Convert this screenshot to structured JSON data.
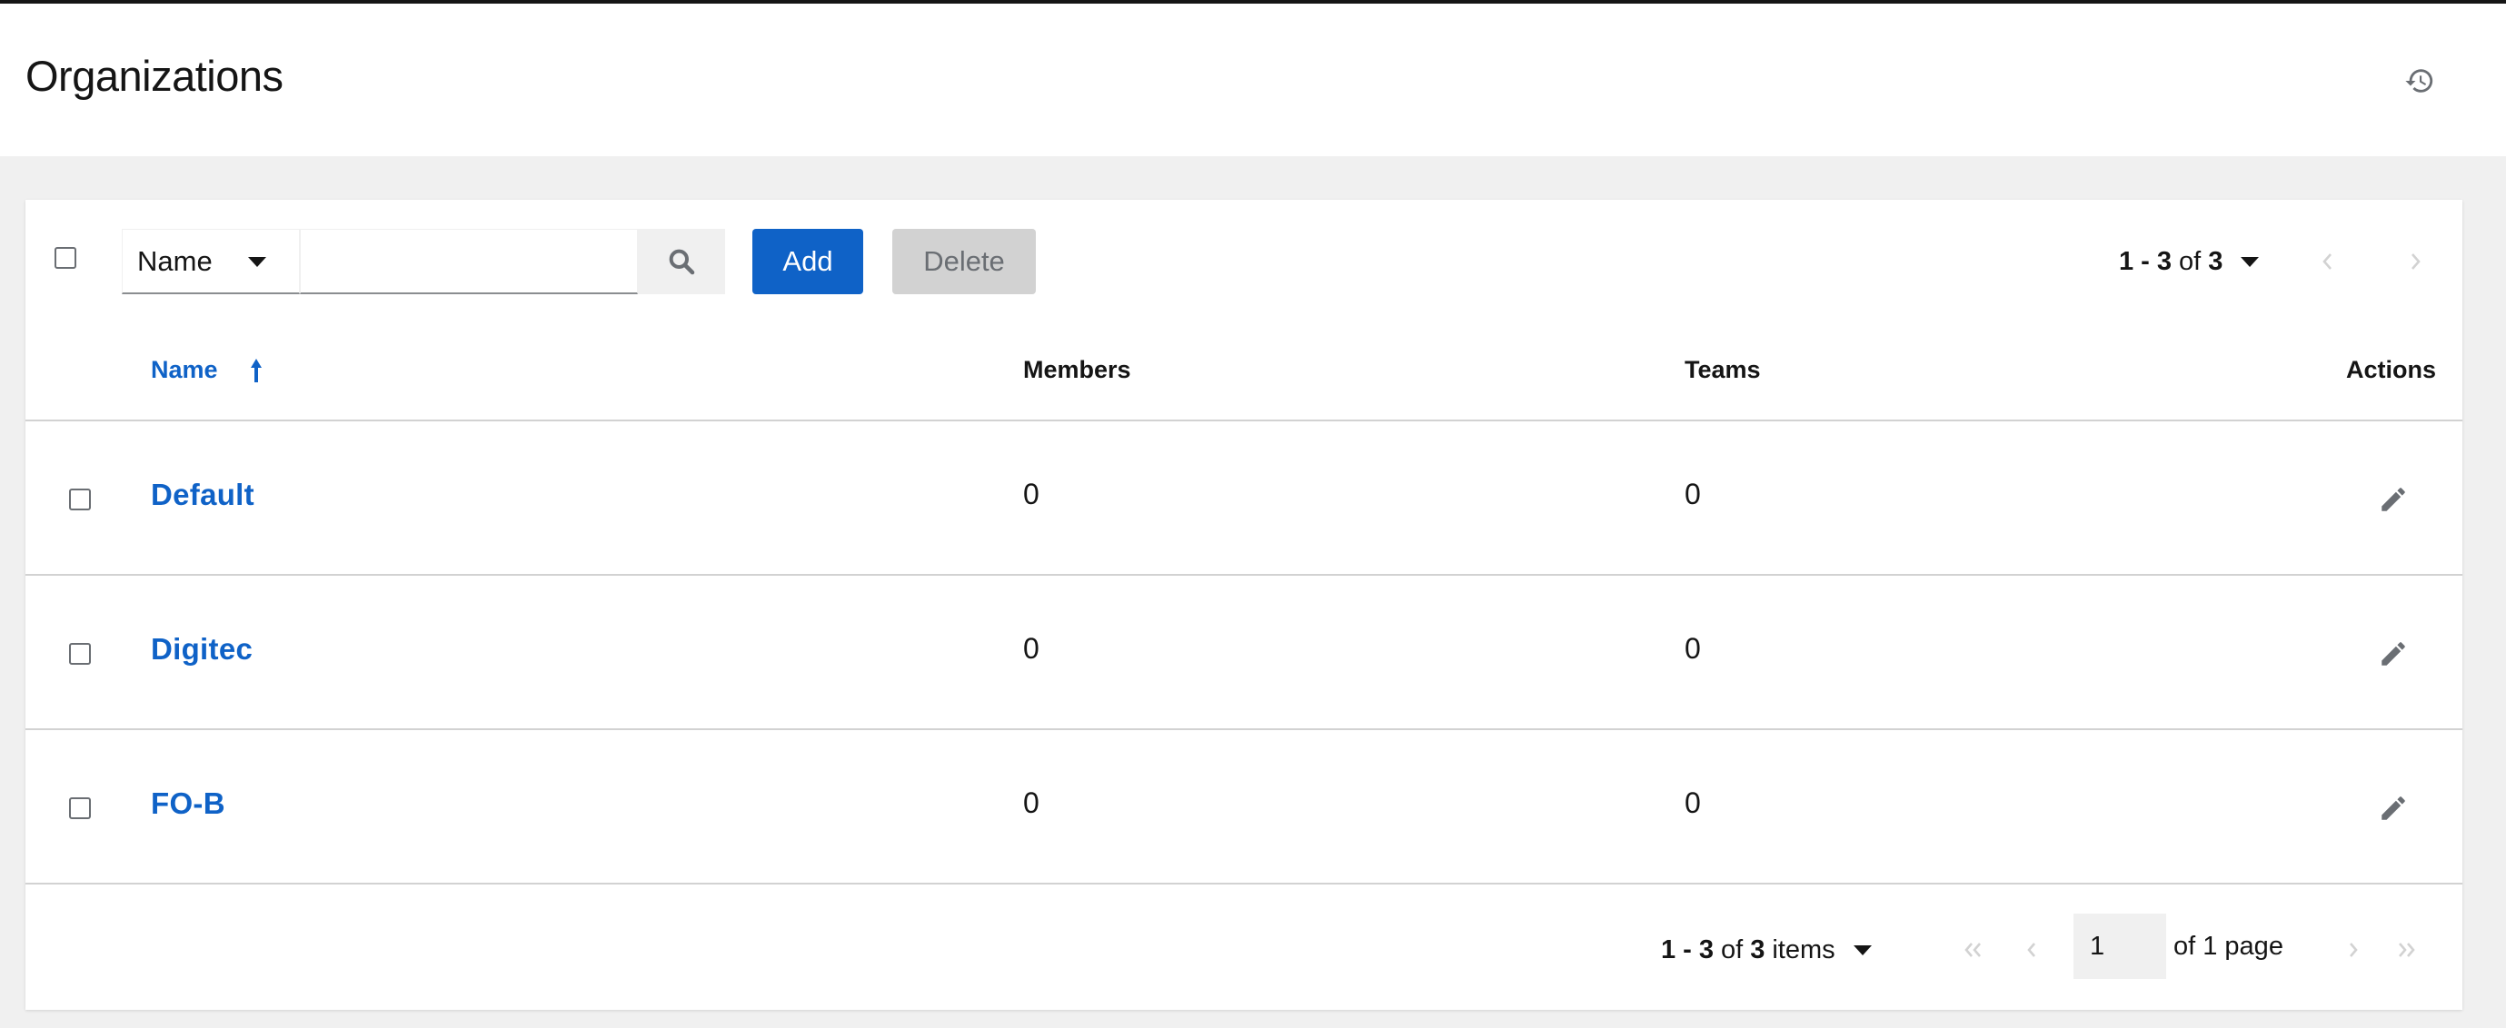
{
  "header": {
    "title": "Organizations",
    "history_icon": "history-icon"
  },
  "toolbar": {
    "filter_select_value": "Name",
    "search_value": "",
    "add_label": "Add",
    "delete_label": "Delete",
    "pagination": {
      "range": "1 - 3",
      "of": "of",
      "total": "3"
    }
  },
  "table": {
    "columns": {
      "name": "Name",
      "members": "Members",
      "teams": "Teams",
      "actions": "Actions"
    },
    "rows": [
      {
        "name": "Default",
        "members": "0",
        "teams": "0"
      },
      {
        "name": "Digitec",
        "members": "0",
        "teams": "0"
      },
      {
        "name": "FO-B",
        "members": "0",
        "teams": "0"
      }
    ]
  },
  "footer": {
    "range": "1 - 3",
    "of": "of",
    "total": "3",
    "items_label": "items",
    "page_value": "1",
    "of_pages": "of 1 page"
  },
  "colors": {
    "accent": "#0f62c7",
    "disabled": "#d2d2d2",
    "page_bg": "#f0f0f0"
  }
}
